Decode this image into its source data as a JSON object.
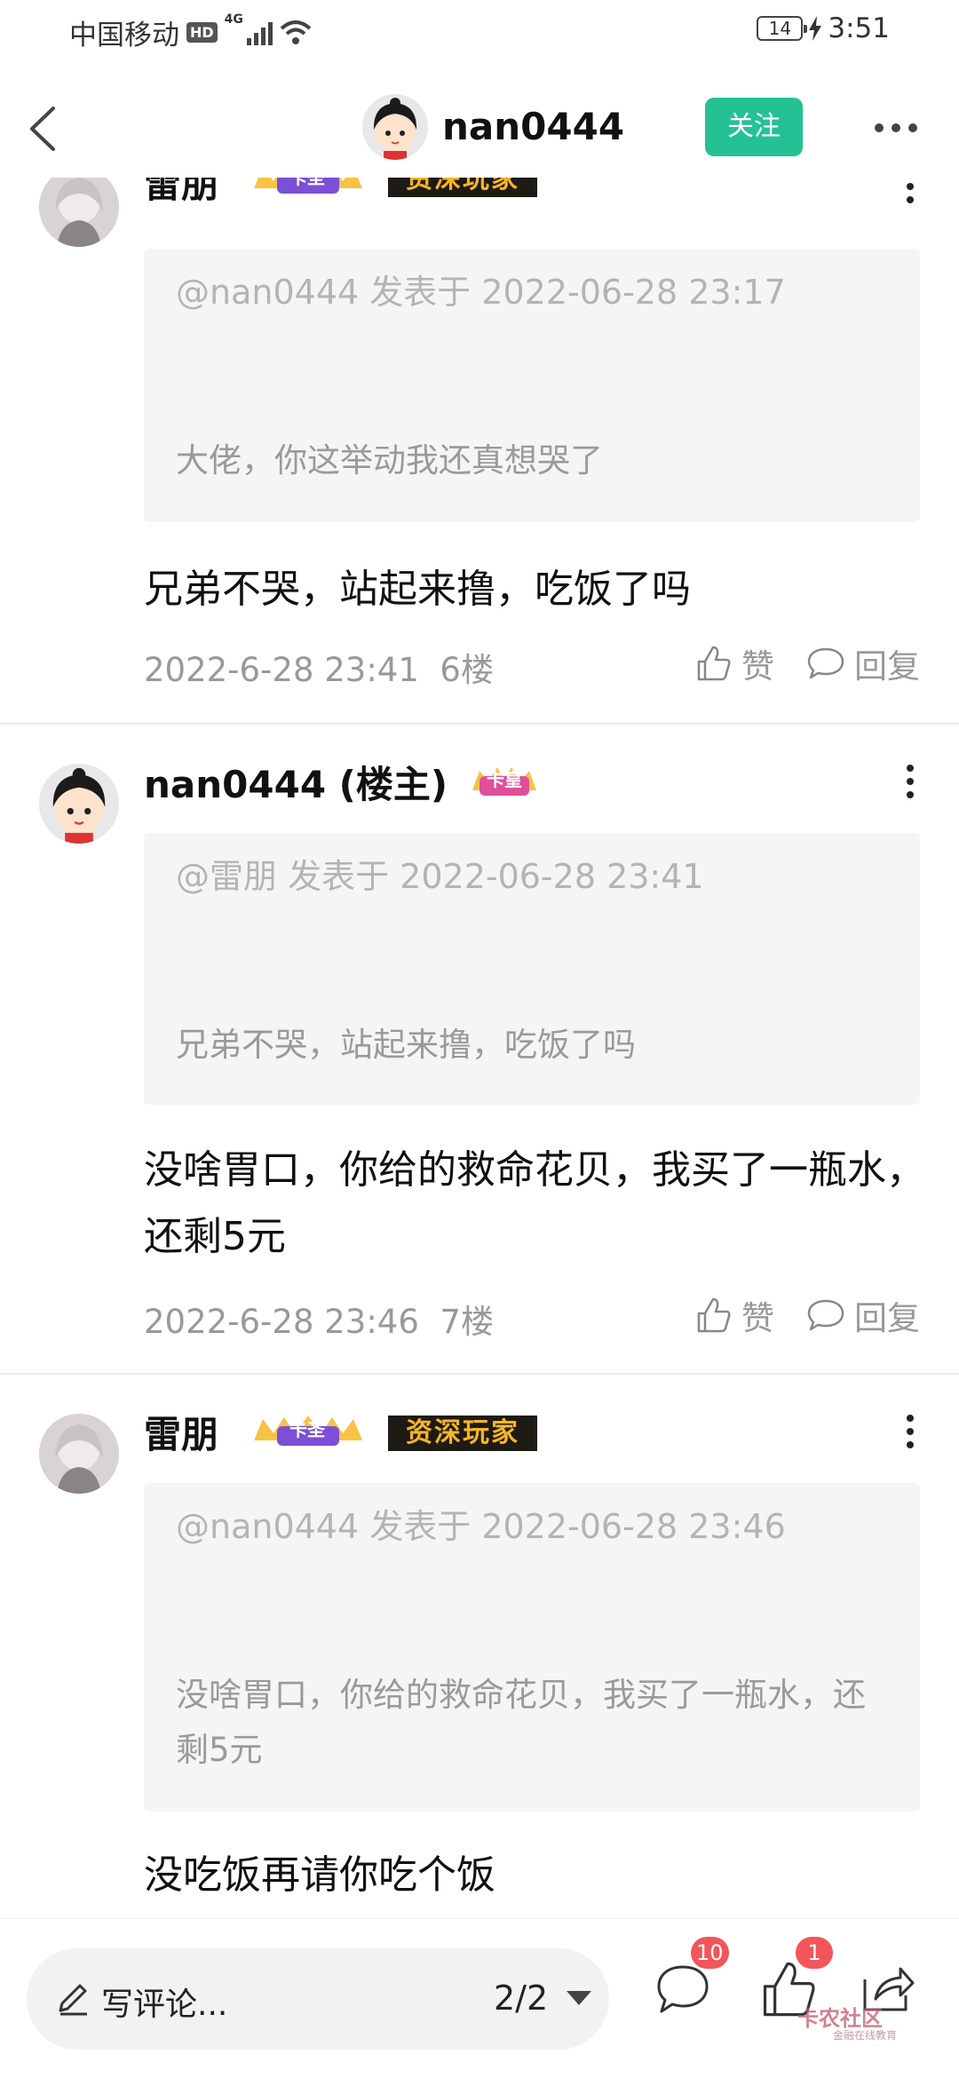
{
  "status_bar": {
    "carrier": "中国移动",
    "hd": "HD",
    "network": "4G",
    "battery": "14",
    "time": "3:51"
  },
  "header": {
    "username": "nan0444",
    "follow_label": "关注",
    "icons": {
      "back": "chevron-left-icon",
      "more": "more-horizontal-icon"
    }
  },
  "comments": [
    {
      "author": "雷朋",
      "crown_badge": "卡圣",
      "senior_badge": "资深玩家",
      "quote_header": "@nan0444 发表于 2022-06-28 23:17",
      "quote_body": "大佬，你这举动我还真想哭了",
      "text": "兄弟不哭，站起来撸，吃饭了吗",
      "date": "2022-6-28 23:41",
      "floor": "6楼",
      "like_label": "赞",
      "reply_label": "回复"
    },
    {
      "author": "nan0444 (楼主)",
      "crown_badge": "卡皇",
      "quote_header": "@雷朋 发表于 2022-06-28 23:41",
      "quote_body": "兄弟不哭，站起来撸，吃饭了吗",
      "text": "没啥胃口，你给的救命花贝，我买了一瓶水，还剩5元",
      "date": "2022-6-28 23:46",
      "floor": "7楼",
      "like_label": "赞",
      "reply_label": "回复"
    },
    {
      "author": "雷朋",
      "crown_badge": "卡圣",
      "senior_badge": "资深玩家",
      "quote_header": "@nan0444 发表于 2022-06-28 23:46",
      "quote_body": "没啥胃口，你给的救命花贝，我买了一瓶水，还剩5元",
      "text": "没吃饭再请你吃个饭"
    }
  ],
  "bottom_bar": {
    "placeholder": "写评论...",
    "page": "2/2",
    "comment_count": "10",
    "like_count": "1",
    "watermark": "卡农社区",
    "watermark_sub": "金融在线教育",
    "icons": {
      "pen": "pen-icon",
      "comment": "comment-icon",
      "like": "thumbs-up-icon",
      "share": "share-icon",
      "dropdown": "triangle-down-icon"
    }
  },
  "colors": {
    "accent": "#24c194",
    "badge_red": "#f2565a",
    "senior_badge_bg": "#1e1a14",
    "senior_badge_text": "#f6b522"
  }
}
